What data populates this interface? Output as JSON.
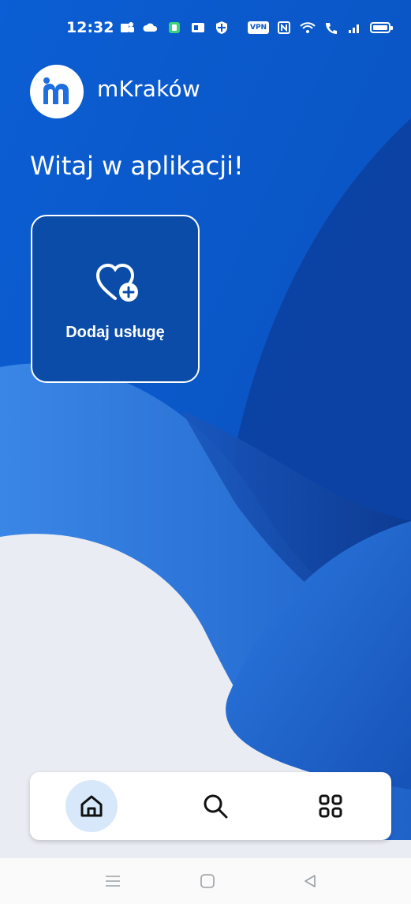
{
  "status_bar": {
    "time": "12:32",
    "vpn_label": "VPN",
    "battery_level": 0.85
  },
  "app": {
    "logo_letter": "m",
    "name": "mKraków",
    "welcome": "Witaj w aplikacji!"
  },
  "service_card": {
    "icon": "heart-plus-icon",
    "label": "Dodaj usługę"
  },
  "bottom_nav": {
    "items": [
      {
        "icon": "home-icon",
        "active": true
      },
      {
        "icon": "search-icon",
        "active": false
      },
      {
        "icon": "grid-icon",
        "active": false
      }
    ]
  },
  "system_nav": {
    "items": [
      "menu-icon",
      "home-square-icon",
      "back-triangle-icon"
    ]
  },
  "colors": {
    "primary_blue": "#0a57c9",
    "dark_blue": "#0a3f99",
    "light_bg": "#e9ecf2",
    "active_nav_bg": "#d7e8fb"
  }
}
